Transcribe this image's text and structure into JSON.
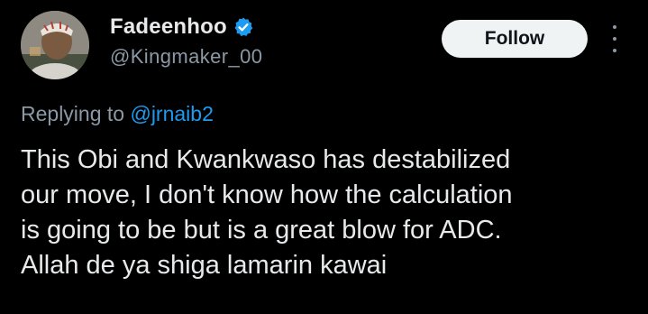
{
  "author": {
    "display_name": "Fadeenhoo",
    "handle": "@Kingmaker_00",
    "verified_icon": "verified-badge-icon",
    "avatar_icon": "avatar"
  },
  "actions": {
    "follow_label": "Follow",
    "more_icon": "more-options-icon"
  },
  "reply": {
    "prefix": "Replying to ",
    "target": "@jrnaib2"
  },
  "tweet": {
    "lines": [
      "This Obi and Kwankwaso has destabilized",
      "our move, I don't know how the calculation",
      "is going to be but is a great blow for ADC.",
      "Allah de ya shiga lamarin kawai"
    ]
  },
  "colors": {
    "background": "#000000",
    "text_primary": "#e7e9ea",
    "text_secondary": "#8b98a5",
    "accent_blue": "#1d9bf0",
    "follow_button_bg": "#eff3f4"
  }
}
